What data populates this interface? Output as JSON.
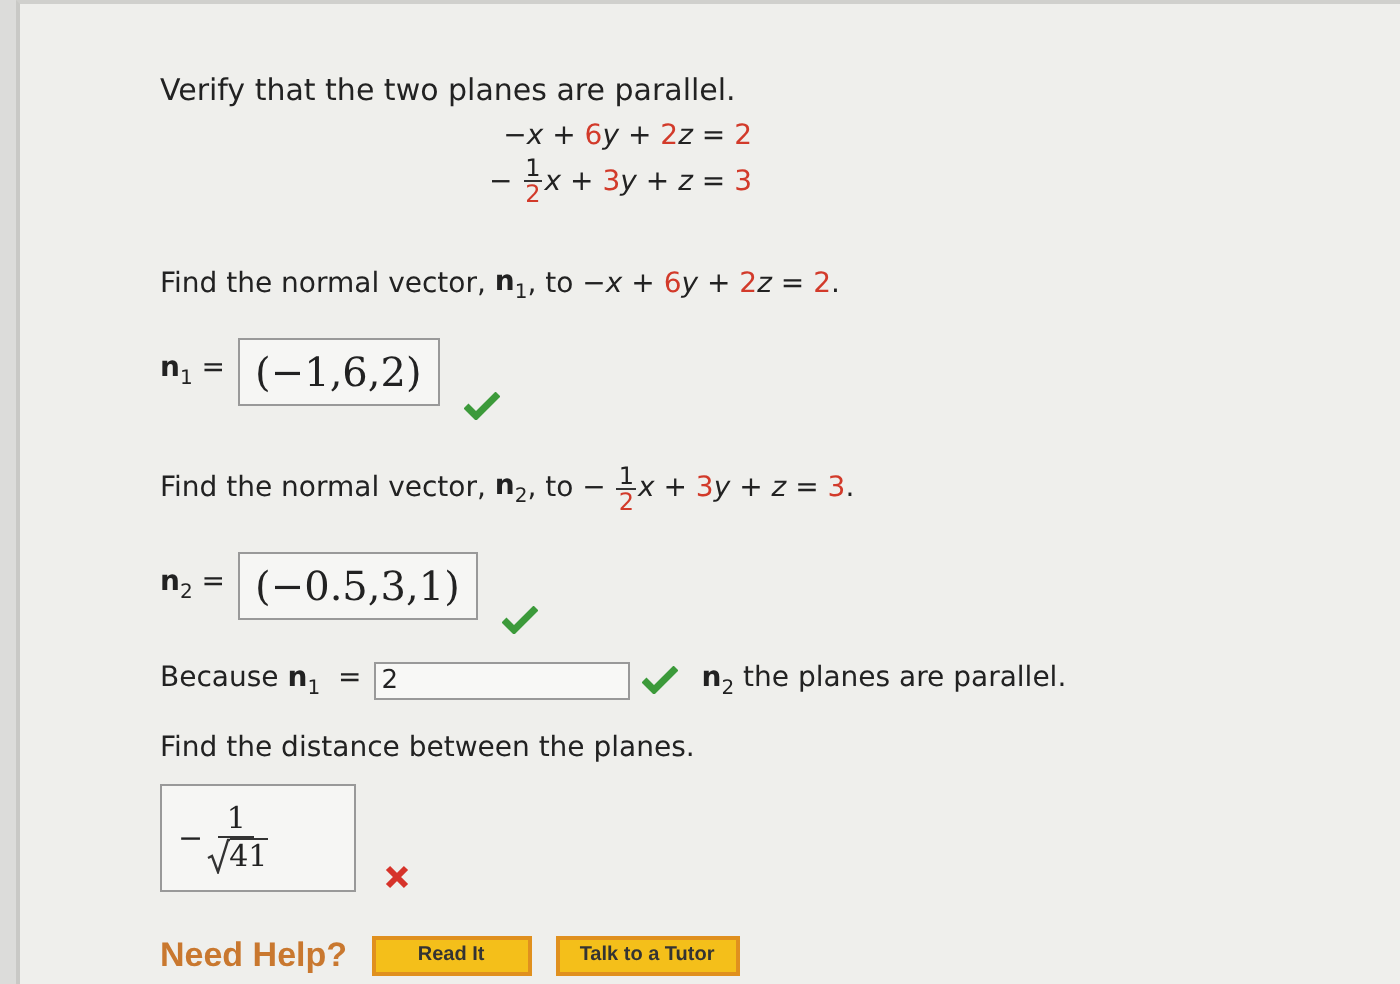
{
  "title": "Verify that the two planes are parallel.",
  "equations": [
    [
      {
        "kind": "op",
        "text": "−"
      },
      {
        "kind": "var",
        "text": "x"
      },
      {
        "kind": "op",
        "text": " + "
      },
      {
        "kind": "num",
        "text": "6"
      },
      {
        "kind": "var",
        "text": "y"
      },
      {
        "kind": "op",
        "text": " + "
      },
      {
        "kind": "num",
        "text": "2"
      },
      {
        "kind": "var",
        "text": "z"
      },
      {
        "kind": "op",
        "text": " = "
      },
      {
        "kind": "num",
        "text": "2"
      }
    ],
    [
      {
        "kind": "op",
        "text": "− "
      },
      {
        "kind": "frac",
        "num": "1",
        "den": "2"
      },
      {
        "kind": "var",
        "text": "x"
      },
      {
        "kind": "op",
        "text": " + "
      },
      {
        "kind": "num",
        "text": "3"
      },
      {
        "kind": "var",
        "text": "y"
      },
      {
        "kind": "op",
        "text": " + "
      },
      {
        "kind": "var",
        "text": "z"
      },
      {
        "kind": "op",
        "text": " = "
      },
      {
        "kind": "num",
        "text": "3"
      }
    ]
  ],
  "parts": [
    {
      "kind": "vector",
      "prompt": "Find the normal vector,",
      "symbol": "n",
      "index": "1",
      "to": ", to",
      "equation": [
        {
          "kind": "op",
          "text": "−"
        },
        {
          "kind": "var",
          "text": "x"
        },
        {
          "kind": "op",
          "text": " + "
        },
        {
          "kind": "num",
          "text": "6"
        },
        {
          "kind": "var",
          "text": "y"
        },
        {
          "kind": "op",
          "text": " + "
        },
        {
          "kind": "num",
          "text": "2"
        },
        {
          "kind": "var",
          "text": "z"
        },
        {
          "kind": "op",
          "text": " = "
        },
        {
          "kind": "num",
          "text": "2"
        }
      ],
      "end": ".",
      "label_symbol": "n",
      "label_index": "1",
      "equals": "=",
      "answer": "(−1,6,2)",
      "correct": true
    },
    {
      "kind": "vector",
      "prompt": "Find the normal vector,",
      "symbol": "n",
      "index": "2",
      "to": ", to",
      "equation": [
        {
          "kind": "op",
          "text": "− "
        },
        {
          "kind": "frac",
          "num": "1",
          "den": "2"
        },
        {
          "kind": "var",
          "text": "x"
        },
        {
          "kind": "op",
          "text": " + "
        },
        {
          "kind": "num",
          "text": "3"
        },
        {
          "kind": "var",
          "text": "y"
        },
        {
          "kind": "op",
          "text": " + "
        },
        {
          "kind": "var",
          "text": "z"
        },
        {
          "kind": "op",
          "text": " = "
        },
        {
          "kind": "num",
          "text": "3"
        }
      ],
      "end": ".",
      "label_symbol": "n",
      "label_index": "2",
      "equals": "=",
      "answer": "(−0.5,3,1)",
      "correct": true
    },
    {
      "kind": "ratio",
      "lead": "Because",
      "symbol": "n",
      "index": "1",
      "equals": "=",
      "answer": "2",
      "correct": true,
      "symbol2": "n",
      "index2": "2",
      "tail": "the planes are parallel."
    },
    {
      "kind": "distance",
      "prompt": "Find the distance between the planes.",
      "sign": "−",
      "num": "1",
      "root": "41",
      "correct": false
    }
  ],
  "help": {
    "label": "Need Help?",
    "buttons": [
      "Read It",
      "Talk to a Tutor"
    ]
  }
}
